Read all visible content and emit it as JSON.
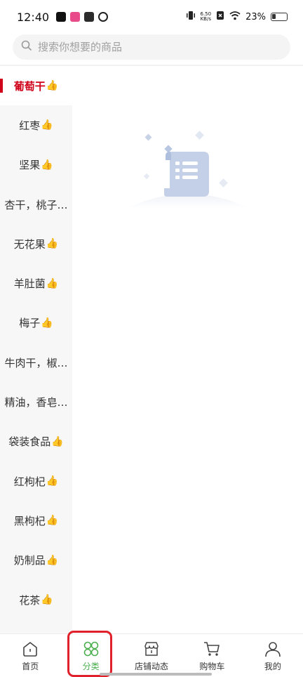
{
  "status": {
    "time": "12:40",
    "speed_top": "6.50",
    "speed_bottom": "KB/s",
    "battery": "23%"
  },
  "search": {
    "placeholder": "搜索你想要的商品"
  },
  "sidebar": {
    "items": [
      {
        "label": "葡萄干",
        "thumb": "👍",
        "active": true
      },
      {
        "label": "红枣",
        "thumb": "👍"
      },
      {
        "label": "坚果",
        "thumb": "👍"
      },
      {
        "label": "杏干，桃子…",
        "thumb": ""
      },
      {
        "label": "无花果",
        "thumb": "👍"
      },
      {
        "label": "羊肚菌",
        "thumb": "👍"
      },
      {
        "label": "梅子",
        "thumb": "👍"
      },
      {
        "label": "牛肉干，椒…",
        "thumb": ""
      },
      {
        "label": "精油，香皂…",
        "thumb": ""
      },
      {
        "label": "袋装食品",
        "thumb": "👍"
      },
      {
        "label": "红枸杞",
        "thumb": "👍"
      },
      {
        "label": "黑枸杞",
        "thumb": "👍"
      },
      {
        "label": "奶制品",
        "thumb": "👍"
      },
      {
        "label": "花茶",
        "thumb": "👍"
      }
    ]
  },
  "nav": {
    "home": "首页",
    "category": "分类",
    "store_news": "店铺动态",
    "cart": "购物车",
    "mine": "我的"
  },
  "colors": {
    "accent_red": "#d0021b",
    "active_green": "#4caf50"
  }
}
